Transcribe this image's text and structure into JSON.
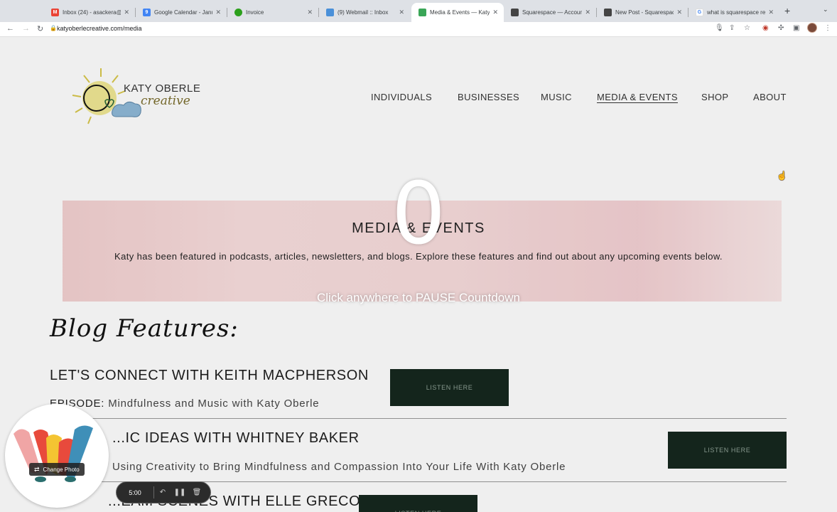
{
  "browser": {
    "tabs": [
      {
        "title": "Inbox (24) - asackera@",
        "fav_color": "#ea4335",
        "fav_glyph": "M",
        "active": false
      },
      {
        "title": "Google Calendar - Janu",
        "fav_color": "#4285f4",
        "fav_glyph": "9",
        "active": false
      },
      {
        "title": "Invoice",
        "fav_color": "#2ca01c",
        "fav_glyph": "qb",
        "active": false
      },
      {
        "title": "(9) Webmail :: Inbox",
        "fav_color": "#4a90d9",
        "fav_glyph": "W",
        "active": false
      },
      {
        "title": "Media & Events — Katy",
        "fav_color": "#3aa657",
        "fav_glyph": "✿",
        "active": true
      },
      {
        "title": "Squarespace — Accoun",
        "fav_color": "#444444",
        "fav_glyph": "S",
        "active": false
      },
      {
        "title": "New Post - Squarespac",
        "fav_color": "#444444",
        "fav_glyph": "S",
        "active": false
      },
      {
        "title": "what is squarespace re",
        "fav_color": "#4285f4",
        "fav_glyph": "G",
        "active": false
      }
    ],
    "url": "katyoberlecreative.com/media"
  },
  "site": {
    "logo": {
      "line1": "KATY OBERLE",
      "line2": "creative"
    },
    "nav": [
      "INDIVIDUALS",
      "BUSINESSES",
      "MUSIC",
      "MEDIA & EVENTS",
      "SHOP",
      "ABOUT"
    ],
    "banner_title": "MEDIA & EVENTS",
    "banner_text": "Katy has been featured in podcasts, articles, newsletters, and blogs. Explore these features and find out about any upcoming events below.",
    "blog_heading": "Blog Features:",
    "features": [
      {
        "title": "LET'S CONNECT WITH KEITH MACPHERSON",
        "label": "EPISODE:",
        "subtitle": "Mindfulness and Music with Katy Oberle",
        "button": "LISTEN HERE"
      },
      {
        "title": "...IC IDEAS WITH WHITNEY BAKER",
        "label": "",
        "subtitle": "Using Creativity to Bring Mindfulness and Compassion Into Your Life With Katy Oberle",
        "button": "LISTEN HERE"
      },
      {
        "title": "...EAM SCENES WITH ELLE GRECO",
        "label": "",
        "subtitle": "",
        "button": "LISTEN HERE"
      }
    ]
  },
  "overlay": {
    "countdown": "0",
    "message": "Click anywhere to PAUSE Countdown"
  },
  "recorder": {
    "change_photo": "Change Photo",
    "time": "5:00"
  }
}
